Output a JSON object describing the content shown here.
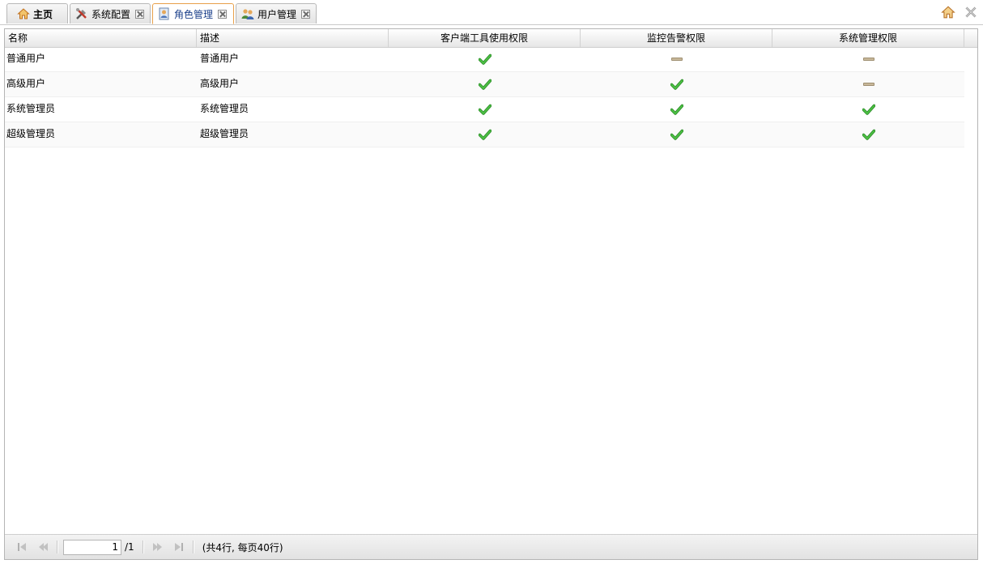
{
  "tabs": [
    {
      "label": "主页",
      "icon": "home-icon",
      "closable": false,
      "active": false
    },
    {
      "label": "系统配置",
      "icon": "tools-icon",
      "closable": true,
      "active": false
    },
    {
      "label": "角色管理",
      "icon": "role-icon",
      "closable": true,
      "active": true
    },
    {
      "label": "用户管理",
      "icon": "users-icon",
      "closable": true,
      "active": false
    }
  ],
  "toolbar": {
    "home_icon": "home-icon",
    "close_all_icon": "close-all-icon"
  },
  "grid": {
    "columns": [
      "名称",
      "描述",
      "客户端工具使用权限",
      "监控告警权限",
      "系统管理权限"
    ],
    "rows": [
      {
        "name": "普通用户",
        "desc": "普通用户",
        "client": true,
        "monitor": false,
        "admin": false
      },
      {
        "name": "高级用户",
        "desc": "高级用户",
        "client": true,
        "monitor": true,
        "admin": false
      },
      {
        "name": "系统管理员",
        "desc": "系统管理员",
        "client": true,
        "monitor": true,
        "admin": true
      },
      {
        "name": "超级管理员",
        "desc": "超级管理员",
        "client": true,
        "monitor": true,
        "admin": true
      }
    ]
  },
  "pager": {
    "current_page": "1",
    "total_pages": "/1",
    "summary": "(共4行, 每页40行)"
  },
  "colors": {
    "check": "#3aa935",
    "active_tab_border": "#e8a04a",
    "active_tab_text": "#1a3f8a"
  }
}
